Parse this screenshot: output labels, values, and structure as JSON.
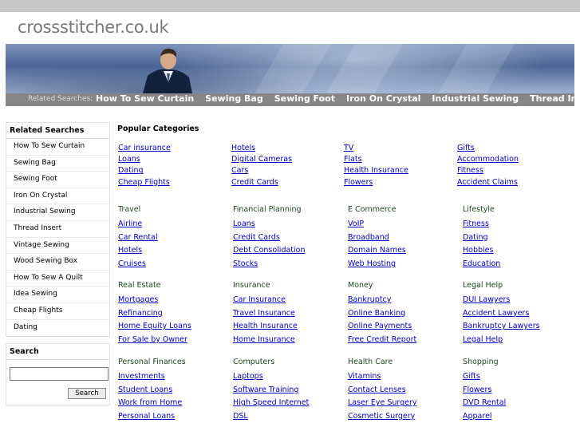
{
  "site": {
    "domain": "crossstitcher.co.uk"
  },
  "related_bar": {
    "label": "Related Searches:",
    "links": [
      "How To Sew Curtain",
      "Sewing Bag",
      "Sewing Foot",
      "Iron On Crystal",
      "Industrial Sewing",
      "Thread Insert"
    ]
  },
  "sidebar": {
    "heading": "Related Searches",
    "items": [
      "How To Sew Curtain",
      "Sewing Bag",
      "Sewing Foot",
      "Iron On Crystal",
      "Industrial Sewing",
      "Thread Insert",
      "Vintage Sewing",
      "Wood Sewing Box",
      "How To Sew A Quilt",
      "Idea Sewing",
      "Cheap Flights",
      "Dating"
    ]
  },
  "search": {
    "heading": "Search",
    "button": "Search",
    "value": ""
  },
  "popular": {
    "heading": "Popular Categories",
    "columns": [
      [
        "Car insurance",
        "Loans",
        "Dating",
        "Cheap Flights"
      ],
      [
        "Hotels",
        "Digital Cameras",
        "Cars",
        "Credit Cards"
      ],
      [
        "TV",
        "Flats",
        "Health Insurance",
        "Flowers"
      ],
      [
        "Gifts",
        "Accommodation",
        "Fitness",
        "Accident Claims"
      ]
    ]
  },
  "categories": [
    {
      "title": "Travel",
      "links": [
        "Airline",
        "Car Rental",
        "Hotels",
        "Cruises"
      ]
    },
    {
      "title": "Financial Planning",
      "links": [
        "Loans",
        "Credit Cards",
        "Debt Consolidation",
        "Stocks"
      ]
    },
    {
      "title": "E Commerce",
      "links": [
        "VoIP",
        "Broadband",
        "Domain Names",
        "Web Hosting"
      ]
    },
    {
      "title": "Lifestyle",
      "links": [
        "Fitness",
        "Dating",
        "Hobbies",
        "Education"
      ]
    },
    {
      "title": "Real Estate",
      "links": [
        "Mortgages",
        "Refinancing",
        "Home Equity Loans",
        "For Sale by Owner"
      ]
    },
    {
      "title": "Insurance",
      "links": [
        "Car Insurance",
        "Travel Insurance",
        "Health Insurance",
        "Home Insurance"
      ]
    },
    {
      "title": "Money",
      "links": [
        "Bankruptcy",
        "Online Banking",
        "Online Payments",
        "Free Credit Report"
      ]
    },
    {
      "title": "Legal Help",
      "links": [
        "DUI Lawyers",
        "Accident Lawyers",
        "Bankruptcy Lawyers",
        "Legal Help"
      ]
    },
    {
      "title": "Personal Finances",
      "links": [
        "Investments",
        "Student Loans",
        "Work from Home",
        "Personal Loans"
      ]
    },
    {
      "title": "Computers",
      "links": [
        "Laptops",
        "Software Training",
        "High Speed Internet",
        "DSL"
      ]
    },
    {
      "title": "Health Care",
      "links": [
        "Vitamins",
        "Contact Lenses",
        "Laser Eye Surgery",
        "Cosmetic Surgery"
      ]
    },
    {
      "title": "Shopping",
      "links": [
        "Gifts",
        "Flowers",
        "DVD Rental",
        "Apparel"
      ]
    }
  ],
  "colors": {
    "link": "#0000cc",
    "category_title": "#1a4a1a",
    "related_bar": "#868686"
  }
}
